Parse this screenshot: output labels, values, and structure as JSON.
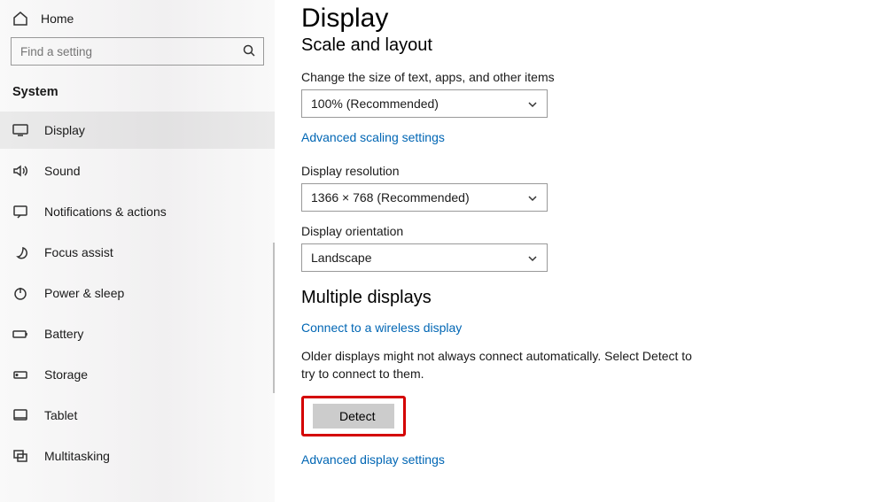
{
  "home": {
    "label": "Home"
  },
  "search": {
    "placeholder": "Find a setting"
  },
  "section_title": "System",
  "nav": [
    {
      "label": "Display",
      "icon": "display-icon",
      "active": true
    },
    {
      "label": "Sound",
      "icon": "sound-icon"
    },
    {
      "label": "Notifications & actions",
      "icon": "notifications-icon"
    },
    {
      "label": "Focus assist",
      "icon": "focus-assist-icon"
    },
    {
      "label": "Power & sleep",
      "icon": "power-icon"
    },
    {
      "label": "Battery",
      "icon": "battery-icon"
    },
    {
      "label": "Storage",
      "icon": "storage-icon"
    },
    {
      "label": "Tablet",
      "icon": "tablet-icon"
    },
    {
      "label": "Multitasking",
      "icon": "multitasking-icon"
    }
  ],
  "page": {
    "title": "Display",
    "scale_header": "Scale and layout",
    "scale_label": "Change the size of text, apps, and other items",
    "scale_value": "100% (Recommended)",
    "advanced_scaling_link": "Advanced scaling settings",
    "resolution_label": "Display resolution",
    "resolution_value": "1366 × 768 (Recommended)",
    "orientation_label": "Display orientation",
    "orientation_value": "Landscape",
    "multiple_header": "Multiple displays",
    "wireless_link": "Connect to a wireless display",
    "detect_desc": "Older displays might not always connect automatically. Select Detect to try to connect to them.",
    "detect_button": "Detect",
    "advanced_display_link": "Advanced display settings"
  }
}
